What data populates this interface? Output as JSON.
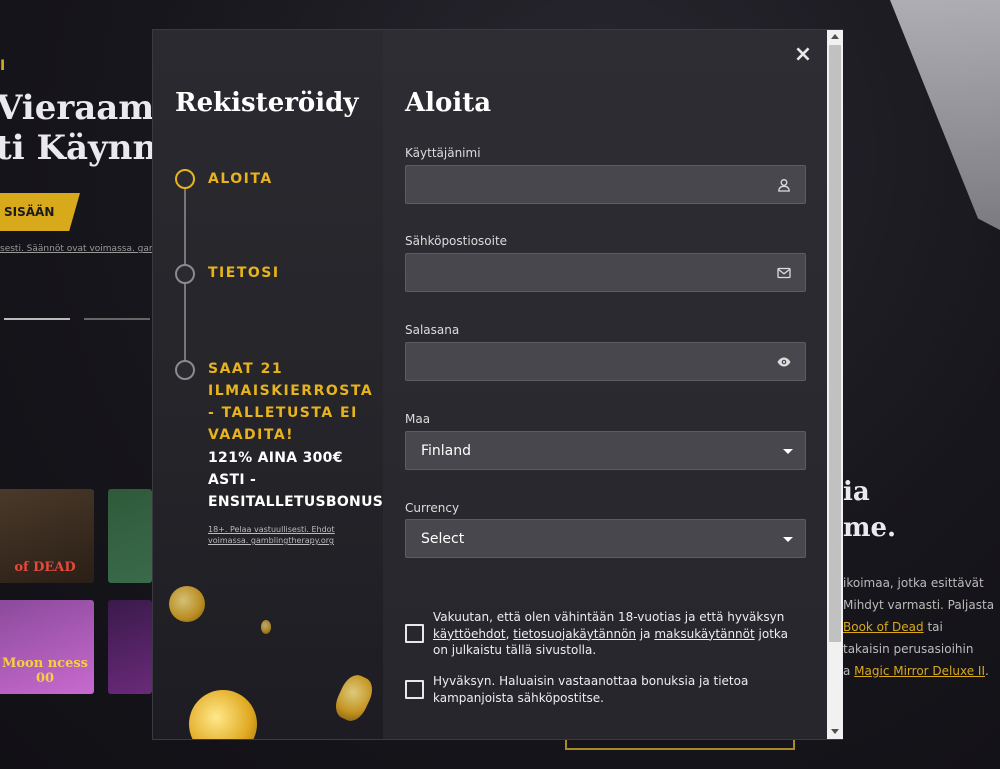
{
  "background": {
    "accent_char": "I",
    "hero_title_line1": "Vieraamm",
    "hero_title_line2": "ti Käynnis",
    "cta_label": "SISÄÄN",
    "terms_text": "sesti. Säännöt ovat voimassa. gamblingt",
    "tile1_label": "of DEAD",
    "tile3_label": "Moon ncess 00",
    "right_title_line1": "ia",
    "right_title_line2": "me.",
    "right_text_line1": "ikoimaa, jotka esittävät",
    "right_text_line2": "Mihdyt varmasti. Paljasta",
    "right_text_line3_link": "Book of Dead",
    "right_text_line3_suffix": " tai",
    "right_text_line4": "takaisin perusasioihin",
    "right_text_line5_prefix": "a ",
    "right_text_line5_link": "Magic Mirror Deluxe II",
    "right_text_line5_suffix": "."
  },
  "modal": {
    "left_title": "Rekisteröidy",
    "steps": [
      {
        "label": "ALOITA",
        "active": true
      },
      {
        "label": "TIETOSI",
        "active": false
      },
      {
        "label": "SAAT 21 ILMAISKIERROSTA - TALLETUSTA EI VAADITA!",
        "active": false
      }
    ],
    "bonus_text": "121% AINA 300€ ASTI - ENSITALLETUSBONUS",
    "bonus_terms": "18+. Pelaa vastuullisesti. Ehdot voimassa. gamblingtherapy.org",
    "close_label": "×",
    "form_title": "Aloita",
    "fields": {
      "username": {
        "label": "Käyttäjänimi",
        "value": "",
        "icon": "user-icon"
      },
      "email": {
        "label": "Sähköpostiosoite",
        "value": "",
        "icon": "envelope-icon"
      },
      "password": {
        "label": "Salasana",
        "value": "",
        "icon": "eye-icon"
      },
      "country": {
        "label": "Maa",
        "value": "Finland"
      },
      "currency": {
        "label": "Currency",
        "value": "Select"
      }
    },
    "age_check": {
      "prefix": "Vakuutan, että olen vähintään 18-vuotias ja että hyväksyn ",
      "link1": "käyttöehdot",
      "sep1": ", ",
      "link2": "tietosuojakäytännön",
      "sep2": " ja ",
      "link3": "maksukäytännöt",
      "suffix": " jotka on julkaistu tällä sivustolla.",
      "checked": false
    },
    "marketing_check": {
      "text": "Hyväksyn. Haluaisin vastaanottaa bonuksia ja tietoa kampanjoista sähköpostitse.",
      "checked": false
    }
  },
  "colors": {
    "accent": "#e8b31c",
    "modal_bg": "#2d2d33",
    "field_bg": "#47474d"
  }
}
